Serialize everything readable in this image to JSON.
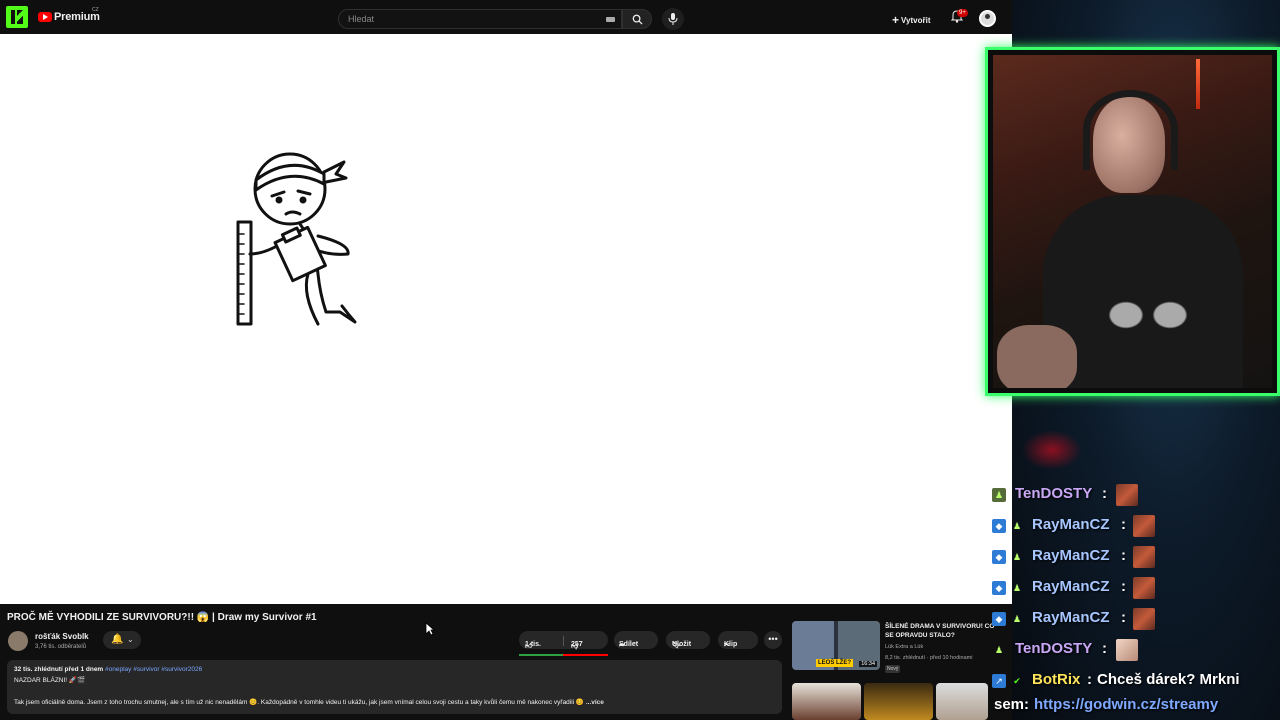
{
  "topbar": {
    "brand": "Premium",
    "region": "CZ",
    "search_placeholder": "Hledat",
    "create_label": "Vytvořit",
    "notification_count": "9+"
  },
  "video": {
    "title": "PROČ MĚ VYHODILI ZE SURVIVORU?!! 😱 | Draw my Survivor #1",
    "channel": "rošťák Svoblk",
    "subscribers": "3,76 tis. odběratelů",
    "likes": "1 tis.",
    "dislikes": "257",
    "share_label": "Sdílet",
    "save_label": "Uložit",
    "clip_label": "Klip",
    "views_date": "32 tis. zhlédnutí  před 1 dnem",
    "hashtags": "#oneplay #survivor #survivor2026",
    "desc_line1": "NAZDAR BLÁZNI! 🚀🎬",
    "desc_line2": "Tak jsem oficiálně doma. Jsem z toho trochu smutnej, ale s tím už nic nenadělám 😊. Každopádně v tomhle videu ti ukážu, jak jsem vnímal celou svoji cestu a taky kvůli čemu mě nakonec vyřadili 😊",
    "more_label": "...více"
  },
  "recommendation": {
    "title": "ŠÍLENÉ DRAMA V SURVIVORU! CO SE OPRAVDU STALO?",
    "channel": "Lük Extra a Lük",
    "stats": "8,2 tis. zhlédnutí · před 10 hodinami",
    "badge": "Nový",
    "duration": "16:34",
    "thumb_text": "LEOŠ LŽE?"
  },
  "chat": [
    {
      "user": "TenDOSTY",
      "color": "#c9a7f5",
      "sep": ":",
      "text": ""
    },
    {
      "user": "RayManCZ",
      "color": "#a7c6ff",
      "sep": ":",
      "text": ""
    },
    {
      "user": "RayManCZ",
      "color": "#a7c6ff",
      "sep": ":",
      "text": ""
    },
    {
      "user": "RayManCZ",
      "color": "#a7c6ff",
      "sep": ":",
      "text": ""
    },
    {
      "user": "RayManCZ",
      "color": "#a7c6ff",
      "sep": ":",
      "text": ""
    },
    {
      "user": "TenDOSTY",
      "color": "#c9a7f5",
      "sep": ":",
      "text": ""
    },
    {
      "user": "BotRix",
      "color": "#ffe55a",
      "sep": ":",
      "text": "Chceš dárek? Mrkni"
    }
  ],
  "chat_tail": {
    "prefix": "sem:",
    "link": "https://godwin.cz/streamy"
  }
}
